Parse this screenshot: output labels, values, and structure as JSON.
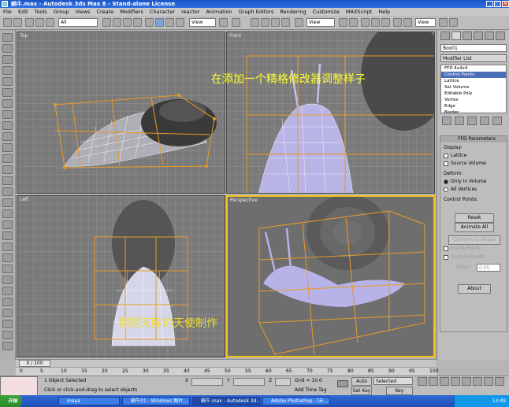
{
  "window": {
    "title": "蜗牛.max - Autodesk 3ds Max 8 - Stand-alone License"
  },
  "menu": [
    "File",
    "Edit",
    "Tools",
    "Group",
    "Views",
    "Create",
    "Modifiers",
    "Character",
    "reactor",
    "Animation",
    "Graph Editors",
    "Rendering",
    "Customize",
    "MAXScript",
    "Help"
  ],
  "toolbar": {
    "selection_filter": "All",
    "ref_coord": "View",
    "named_sel": "View"
  },
  "viewports": {
    "top": "Top",
    "front": "Front",
    "left": "Left",
    "perspective": "Perspective"
  },
  "annotation": {
    "top": "在添加一个精格修改器调整样子",
    "bottom": "翱翔天际的天使制作"
  },
  "command_panel": {
    "object_name": "Box01",
    "modifier_list": "Modifier List",
    "stack": [
      {
        "label": "FFD 4x4x4",
        "selected": false
      },
      {
        "label": "Control Points",
        "selected": true
      },
      {
        "label": "Lattice",
        "selected": false
      },
      {
        "label": "Set Volume",
        "selected": false
      },
      {
        "label": "Editable Poly",
        "selected": false
      },
      {
        "label": "Vertex",
        "selected": false
      },
      {
        "label": "Edge",
        "selected": false
      },
      {
        "label": "Border",
        "selected": false
      }
    ],
    "rollout_title": "FFD Parameters",
    "display_label": "Display:",
    "lattice_label": "Lattice",
    "source_volume_label": "Source Volume",
    "deform_label": "Deform:",
    "only_in_volume": "Only In Volume",
    "all_vertices": "All Vertices",
    "control_points_label": "Control Points:",
    "reset_button": "Reset",
    "animate_all_button": "Animate All",
    "conform_button": "Conform to Shape",
    "inside_points": "Inside Points",
    "outside_points": "Outside Points",
    "offset_label": "Offset:",
    "offset_value": "0.05",
    "about_button": "About"
  },
  "timeline": {
    "frame_display": "0 / 100",
    "ticks": [
      "0",
      "5",
      "10",
      "15",
      "20",
      "25",
      "30",
      "35",
      "40",
      "45",
      "50",
      "55",
      "60",
      "65",
      "70",
      "75",
      "80",
      "85",
      "90",
      "95",
      "100"
    ]
  },
  "status": {
    "objects_selected": "1 Object Selected",
    "prompt": "Click or click-and-drag to select objects",
    "x_label": "X",
    "y_label": "Y",
    "z_label": "Z",
    "grid": "Grid = 10.0",
    "add_time_tag": "Add Time Tag",
    "auto_key": "Auto Key",
    "set_key": "Set Key",
    "selected": "Selected",
    "key_filters": "Key Filters..."
  },
  "taskbar": {
    "start": "开始",
    "tasks": [
      {
        "label": "maya",
        "active": false
      },
      {
        "label": "蜗牛01 - Windows 图片...",
        "active": false
      },
      {
        "label": "蜗牛.max - Autodesk 3d...",
        "active": true
      },
      {
        "label": "Adobe Photoshop - [未...",
        "active": false
      }
    ],
    "clock": "13:49"
  }
}
